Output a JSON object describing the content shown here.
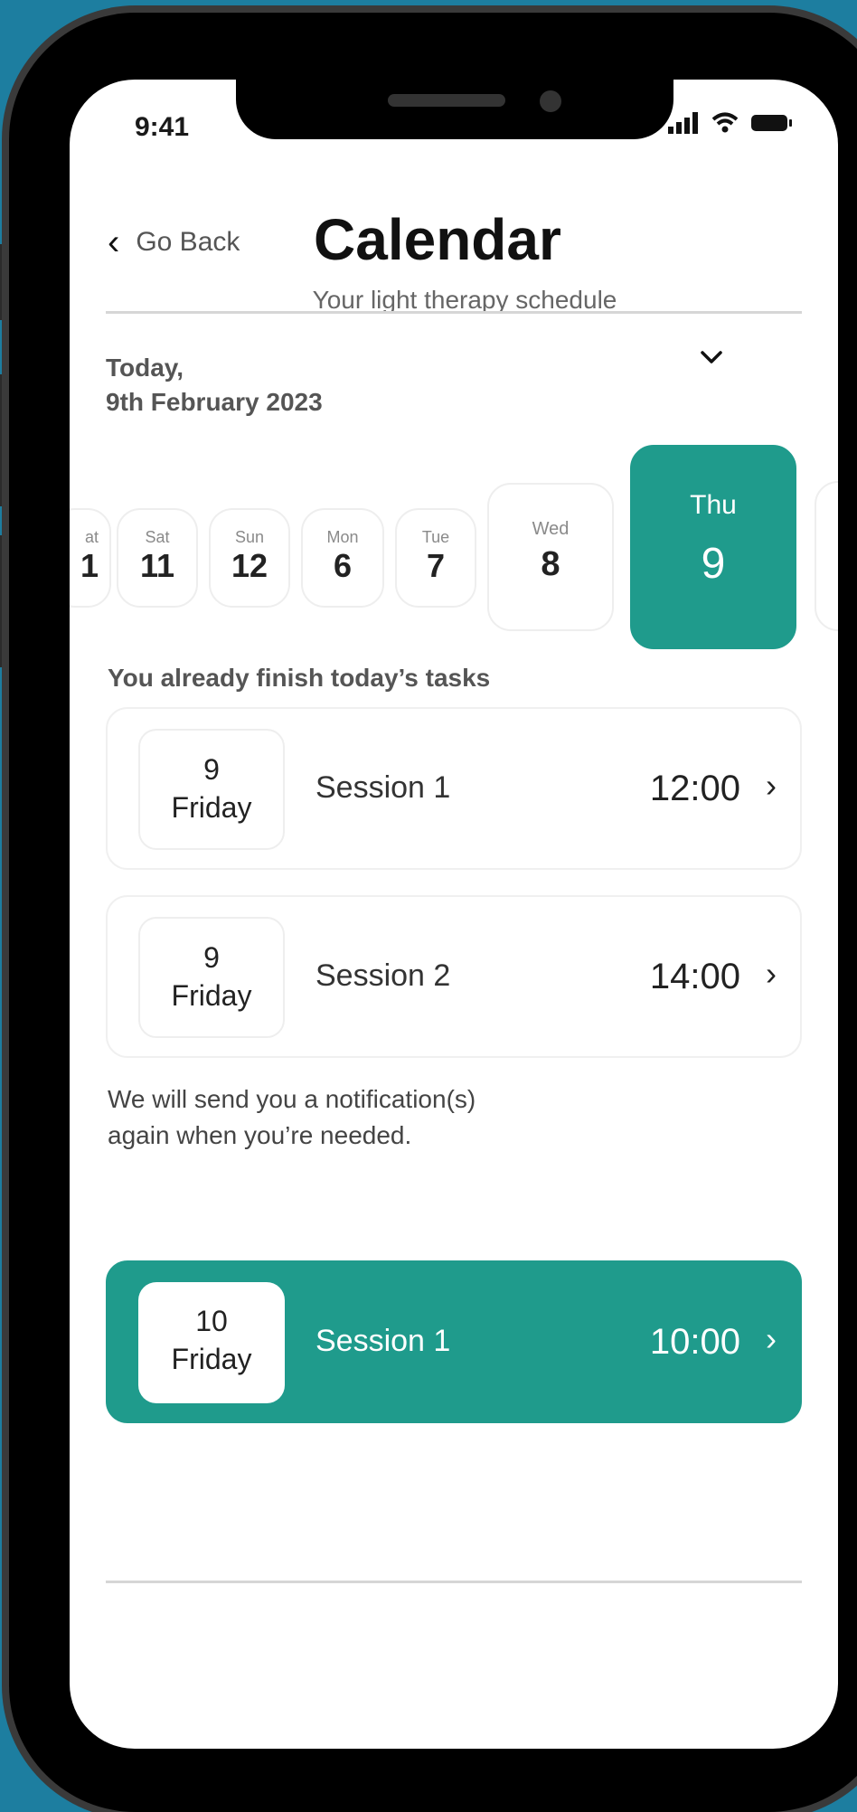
{
  "status": {
    "time": "9:41"
  },
  "header": {
    "back_label": "Go Back",
    "title": "Calendar",
    "subtitle": "Your light therapy schedule"
  },
  "today": {
    "line1": "Today,",
    "line2": "9th February 2023"
  },
  "week": [
    {
      "name": "at",
      "num": "1"
    },
    {
      "name": "Sat",
      "num": "11"
    },
    {
      "name": "Sun",
      "num": "12"
    },
    {
      "name": "Mon",
      "num": "6"
    },
    {
      "name": "Tue",
      "num": "7"
    },
    {
      "name": "Wed",
      "num": "8"
    },
    {
      "name": "Thu",
      "num": "9"
    }
  ],
  "tasks_heading": "You already finish today’s tasks",
  "sessions": [
    {
      "day": "9",
      "weekday": "Friday",
      "label": "Session 1",
      "time": "12:00"
    },
    {
      "day": "9",
      "weekday": "Friday",
      "label": "Session 2",
      "time": "14:00"
    }
  ],
  "notice": {
    "line1": "We will send you a notification(s)",
    "line2": "again when you’re needed."
  },
  "upcoming": {
    "day": "10",
    "weekday": "Friday",
    "label": "Session 1",
    "time": "10:00"
  },
  "colors": {
    "accent": "#1f9b8c",
    "background": "#1d7ea0"
  }
}
